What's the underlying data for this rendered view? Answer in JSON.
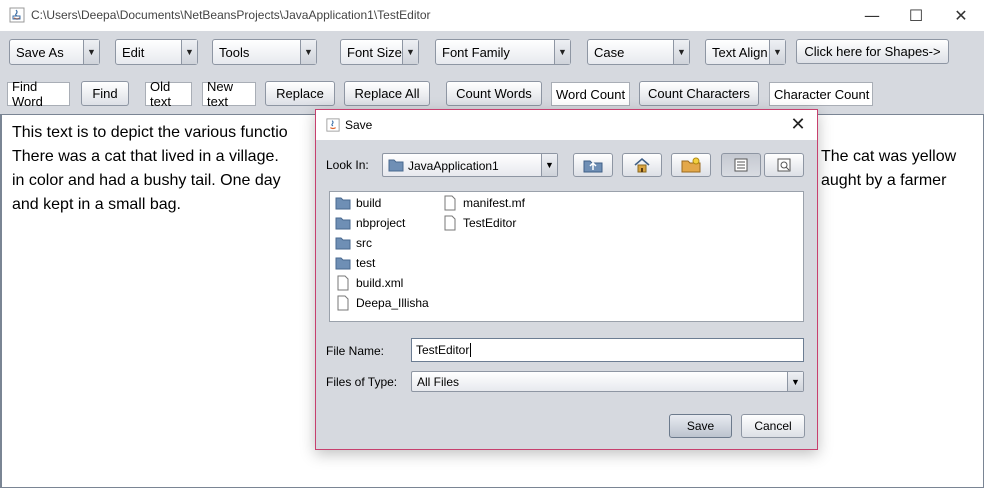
{
  "window": {
    "title": "C:\\Users\\Deepa\\Documents\\NetBeansProjects\\JavaApplication1\\TestEditor",
    "minimize_glyph": "—",
    "maximize_glyph": "☐",
    "close_glyph": "✕"
  },
  "toolbar": {
    "save_as": "Save As",
    "edit": "Edit",
    "tools": "Tools",
    "font_size": "Font Size",
    "font_family": "Font Family",
    "case": "Case",
    "text_align": "Text Align",
    "shapes": "Click here for Shapes->"
  },
  "toolbar2": {
    "find_word_field": "Find Word",
    "find_button": "Find",
    "old_text_field": "Old text",
    "new_text_field": "New text",
    "replace_button": "Replace",
    "replace_all_button": "Replace All",
    "count_words_button": "Count Words",
    "word_count_field": "Word Count",
    "count_characters_button": "Count Characters",
    "character_count_field": "Character Count"
  },
  "editor": {
    "lines": [
      {
        "left": "This text is to depict the various functio",
        "right": ""
      },
      {
        "left": "There was a cat that lived in a village.",
        "right": "The cat was yellow"
      },
      {
        "left": "in color and had a bushy tail. One day",
        "right": "aught by a farmer"
      },
      {
        "left": "and kept in a small bag.",
        "right": ""
      }
    ]
  },
  "dialog": {
    "title": "Save",
    "look_in_label": "Look In:",
    "look_in_value": "JavaApplication1",
    "files": [
      {
        "name": "build",
        "type": "folder"
      },
      {
        "name": "nbproject",
        "type": "folder"
      },
      {
        "name": "src",
        "type": "folder"
      },
      {
        "name": "test",
        "type": "folder"
      },
      {
        "name": "build.xml",
        "type": "file"
      },
      {
        "name": "Deepa_Illisha",
        "type": "file"
      },
      {
        "name": "manifest.mf",
        "type": "file"
      },
      {
        "name": "TestEditor",
        "type": "file"
      }
    ],
    "file_name_label": "File Name:",
    "file_name_value": "TestEditor",
    "files_of_type_label": "Files of Type:",
    "files_of_type_value": "All Files",
    "save_button": "Save",
    "cancel_button": "Cancel"
  },
  "colors": {
    "toolbar_bg": "#d6d9df",
    "dialog_border": "#c7406e",
    "folder_icon": "#6f8fb5"
  }
}
